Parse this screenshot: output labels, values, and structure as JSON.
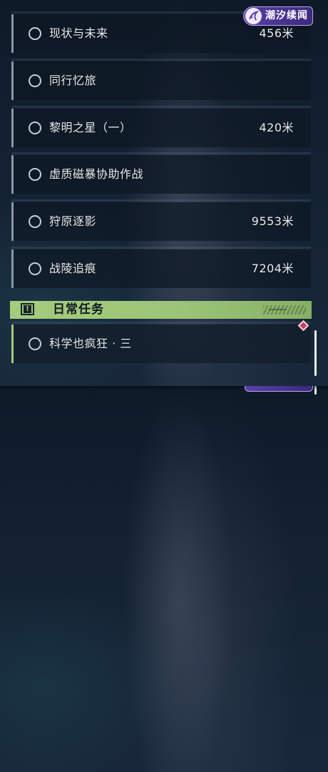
{
  "logo": {
    "text": "潮汐续闻"
  },
  "quests": [
    {
      "name": "现状与未来",
      "distance": "456米"
    },
    {
      "name": "同行忆旅",
      "distance": ""
    },
    {
      "name": "黎明之星（一）",
      "distance": "420米"
    },
    {
      "name": "虚质磁暴协助作战",
      "distance": ""
    },
    {
      "name": "狩原逐影",
      "distance": "9553米"
    },
    {
      "name": "战陵追痕",
      "distance": "7204米"
    }
  ],
  "daily_section": {
    "title": "日常任务",
    "icon": "alert-icon",
    "color": "#a5cc7c",
    "quests": [
      {
        "name": "科学也疯狂 · 三",
        "distance": ""
      }
    ]
  },
  "colors": {
    "accent": "#a5cc7c",
    "track_marker": "#c8415a",
    "logo": "#5a3fa8"
  }
}
